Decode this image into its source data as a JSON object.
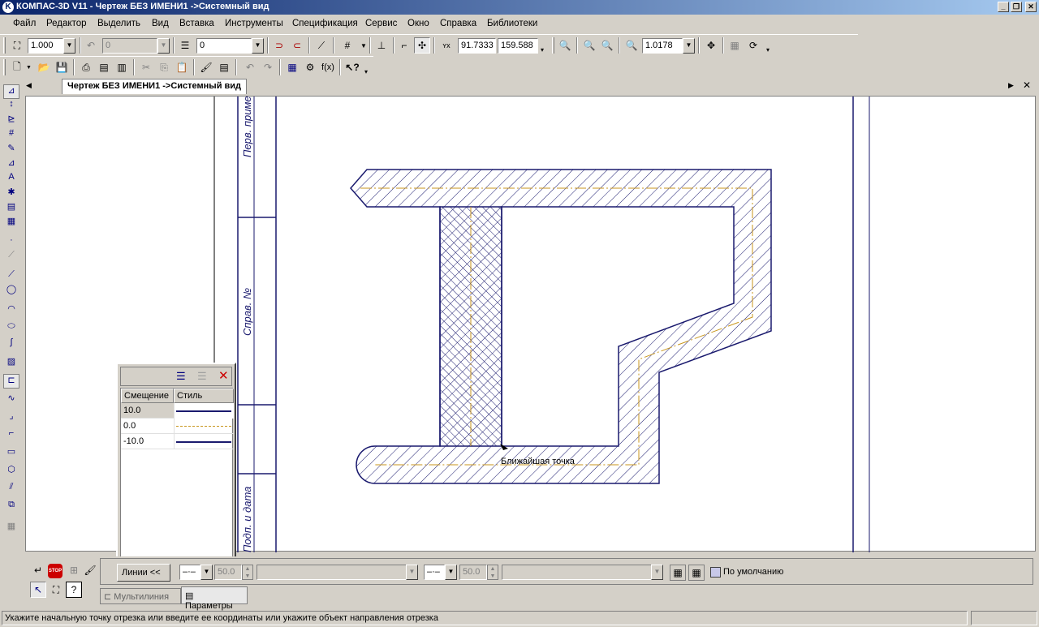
{
  "window": {
    "app_letter": "K",
    "title": "КОМПАС-3D V11 - Чертеж БЕЗ ИМЕНИ1 ->Системный вид"
  },
  "menu": [
    "Файл",
    "Редактор",
    "Выделить",
    "Вид",
    "Вставка",
    "Инструменты",
    "Спецификация",
    "Сервис",
    "Окно",
    "Справка",
    "Библиотеки"
  ],
  "toolbar1": {
    "scale": "1.000",
    "step": "0",
    "layer": "0",
    "coord_x": "91.7333",
    "coord_y": "159.588",
    "zoom": "1.0178"
  },
  "document": {
    "tab_label": "Чертеж БЕЗ ИМЕНИ1 ->Системный вид"
  },
  "frame_labels": [
    "Перв. примен.",
    "Справ. №",
    "Подп. и дата"
  ],
  "snap_hint": "Ближайшая точка",
  "multiline_panel": {
    "col_offset": "Смещение",
    "col_style": "Стиль",
    "rows": [
      {
        "offset": "10.0",
        "style": "solid"
      },
      {
        "offset": "0.0",
        "style": "axial"
      },
      {
        "offset": "-10.0",
        "style": "solid"
      }
    ]
  },
  "properties": {
    "lines_button": "Линии <<",
    "value1": "50.0",
    "value2": "50.0",
    "default_label": "По умолчанию",
    "tab_multiline": "Мультилиния",
    "tab_params": "Параметры"
  },
  "status": {
    "text": "Укажите начальную точку отрезка или введите ее координаты или укажите объект направления отрезка"
  },
  "colors": {
    "title_start": "#0a246a",
    "title_end": "#a6caf0",
    "drawing_line": "#1a1a6e",
    "axis_line": "#c8961e"
  }
}
